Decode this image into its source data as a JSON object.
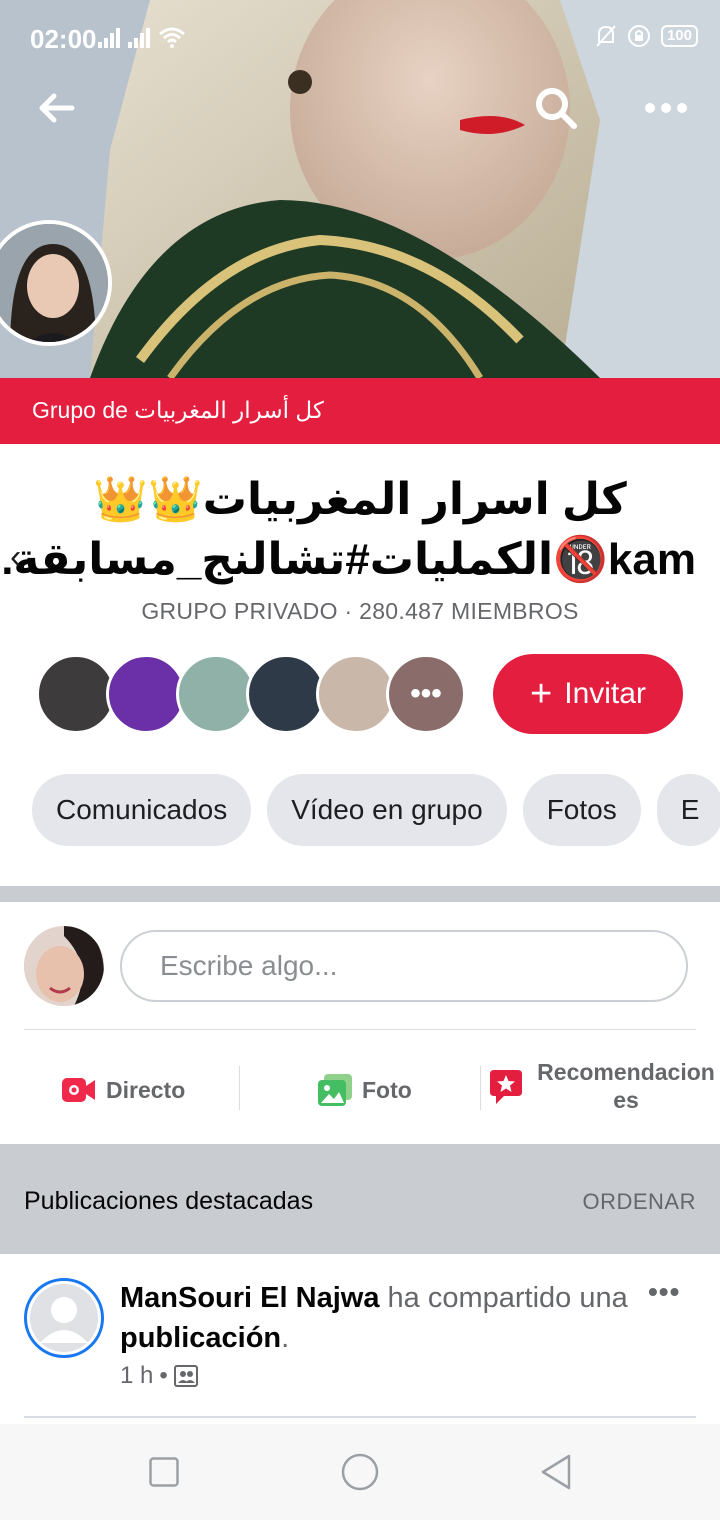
{
  "status_bar": {
    "time": "02:00",
    "battery": "100"
  },
  "banner": {
    "text": "Grupo de كل أسرار المغربيات"
  },
  "group": {
    "title_line1": "كل اسرار المغربيات👑👑",
    "title_line2": "kam🔞الكمليات#تشالنج_مسابقة...",
    "meta": "GRUPO PRIVADO · 280.487 MIEMBROS"
  },
  "invite": {
    "label": "Invitar"
  },
  "tabs": [
    {
      "label": "Comunicados"
    },
    {
      "label": "Vídeo en grupo"
    },
    {
      "label": "Fotos"
    },
    {
      "label": "E"
    }
  ],
  "composer": {
    "placeholder": "Escribe algo..."
  },
  "actions": [
    {
      "label": "Directo"
    },
    {
      "label": "Foto"
    },
    {
      "label": "Recomendaciones"
    }
  ],
  "featured": {
    "title": "Publicaciones destacadas",
    "sort": "ORDENAR"
  },
  "post": {
    "author": "ManSouri El Najwa",
    "action": "ha compartido",
    "article": "una",
    "object": "publicación",
    "time": "1 h"
  },
  "icons": {
    "back": "arrow-left-icon",
    "search": "search-icon",
    "more": "more-horizontal-icon",
    "live": "video-camera-icon",
    "photo": "photo-icon",
    "recommend": "star-bubble-icon"
  },
  "colors": {
    "brand_red": "#e41e3f",
    "facebook_blue": "#1877f2"
  }
}
